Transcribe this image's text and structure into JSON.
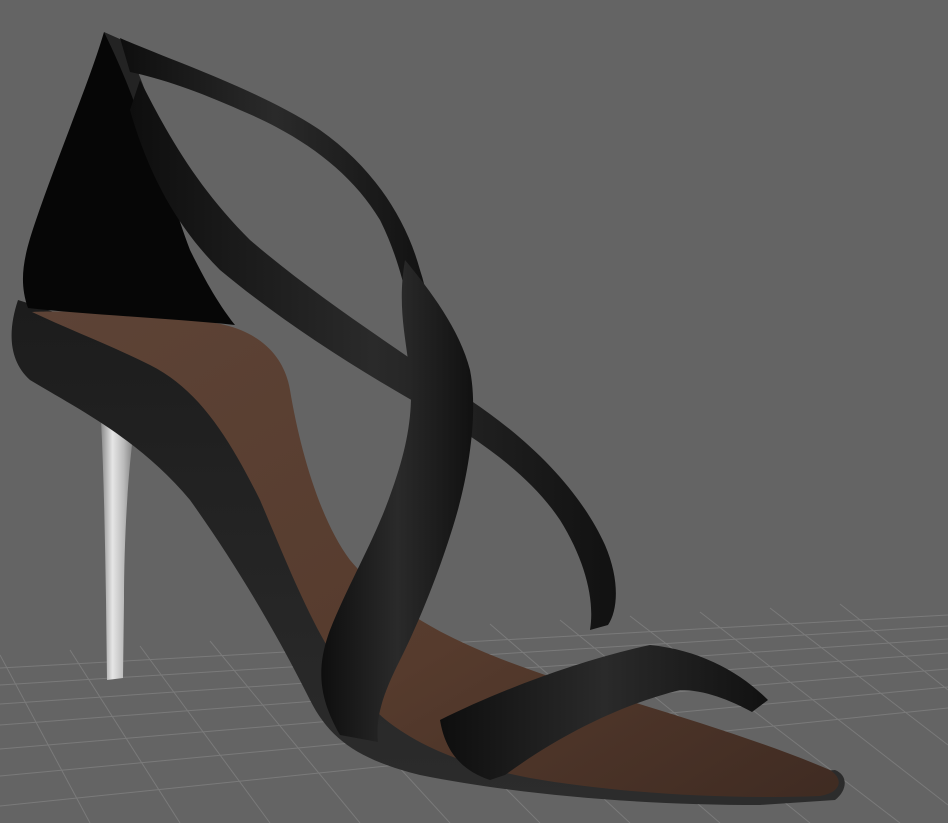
{
  "viewport": {
    "background_color": "#646464",
    "grid_color": "#7a7a7a",
    "grid_visible": true
  },
  "model": {
    "object": "high-heel-sandal",
    "strap_color": "#141414",
    "insole_color": "#5a4032",
    "heel_color": "#c0c0c0"
  }
}
